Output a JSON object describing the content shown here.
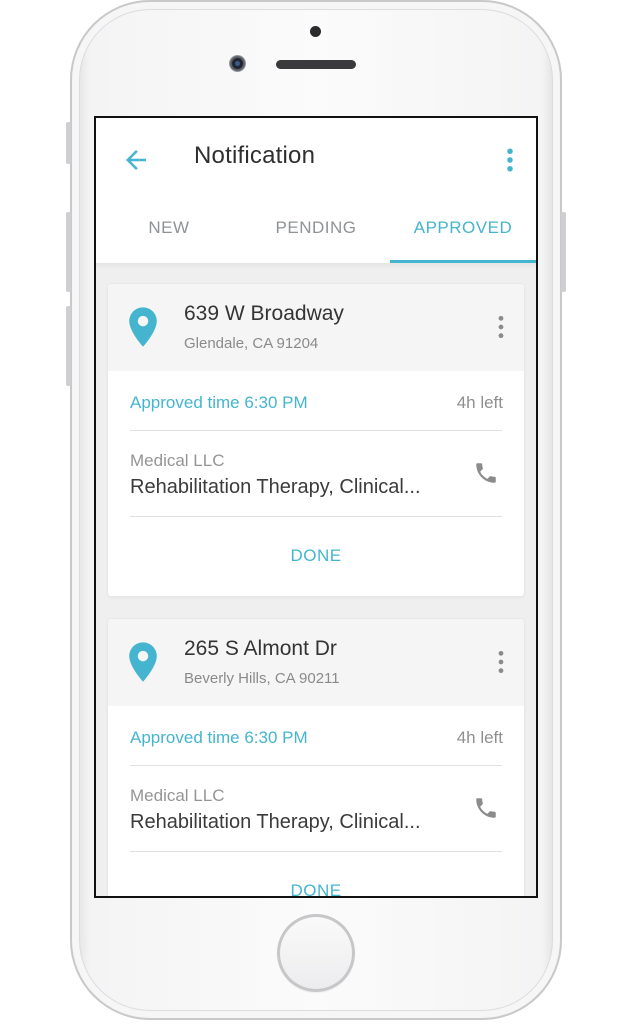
{
  "header": {
    "title": "Notification"
  },
  "tabs": [
    {
      "label": "NEW",
      "active": false
    },
    {
      "label": "PENDING",
      "active": false
    },
    {
      "label": "APPROVED",
      "active": true
    }
  ],
  "cards": [
    {
      "address": "639 W Broadway",
      "city": "Glendale, CA 91204",
      "approved_time": "Approved time 6:30 PM",
      "time_left": "4h left",
      "company": "Medical LLC",
      "service": "Rehabilitation Therapy, Clinical...",
      "action": "DONE"
    },
    {
      "address": "265 S Almont Dr",
      "city": "Beverly Hills, CA 90211",
      "approved_time": "Approved time 6:30 PM",
      "time_left": "4h left",
      "company": "Medical LLC",
      "service": "Rehabilitation Therapy, Clinical...",
      "action": "DONE"
    }
  ],
  "colors": {
    "accent": "#45b5cf",
    "text_dark": "#343434",
    "text_muted": "#8f8f8f"
  },
  "icons": [
    "back-arrow-icon",
    "more-vert-icon",
    "location-pin-icon",
    "phone-icon"
  ]
}
